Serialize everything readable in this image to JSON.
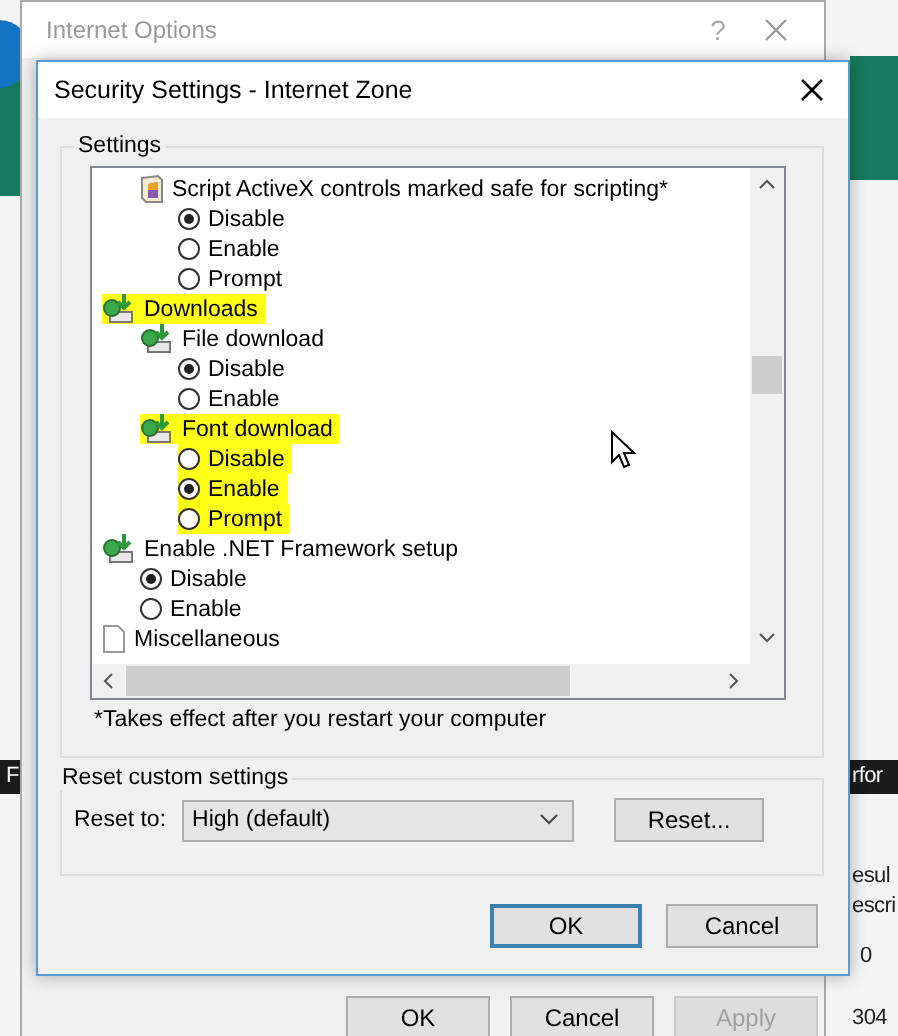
{
  "background": {
    "fragments": [
      "F",
      "rfor",
      "esul",
      "escri",
      "0",
      "304"
    ]
  },
  "internet_options": {
    "title": "Internet Options",
    "help": "?",
    "buttons": [
      {
        "label": "OK",
        "disabled": false
      },
      {
        "label": "Cancel",
        "disabled": false
      },
      {
        "label": "Apply",
        "disabled": true
      }
    ]
  },
  "dialog": {
    "title": "Security Settings - Internet Zone",
    "settings_label": "Settings",
    "tree": [
      {
        "kind": "hidden",
        "children": [
          {
            "kind": "script",
            "label": "Script ActiveX controls marked safe for scripting*",
            "highlighted": false,
            "options": [
              {
                "label": "Disable",
                "selected": true
              },
              {
                "label": "Enable",
                "selected": false
              },
              {
                "label": "Prompt",
                "selected": false
              }
            ]
          }
        ]
      },
      {
        "kind": "download",
        "label": "Downloads",
        "highlighted": true,
        "children": [
          {
            "kind": "download",
            "label": "File download",
            "highlighted": false,
            "options": [
              {
                "label": "Disable",
                "selected": true
              },
              {
                "label": "Enable",
                "selected": false
              }
            ]
          },
          {
            "kind": "download",
            "label": "Font download",
            "highlighted": true,
            "options": [
              {
                "label": "Disable",
                "selected": false
              },
              {
                "label": "Enable",
                "selected": true
              },
              {
                "label": "Prompt",
                "selected": false
              }
            ]
          }
        ]
      },
      {
        "kind": "download",
        "label": "Enable .NET Framework setup",
        "highlighted": false,
        "options": [
          {
            "label": "Disable",
            "selected": true
          },
          {
            "label": "Enable",
            "selected": false
          }
        ]
      },
      {
        "kind": "page",
        "label": "Miscellaneous",
        "highlighted": false
      }
    ],
    "note": "*Takes effect after you restart your computer",
    "reset_group": "Reset custom settings",
    "reset_to_label": "Reset to:",
    "reset_to_value": "High (default)",
    "reset_button": "Reset...",
    "buttons": [
      {
        "label": "OK",
        "default": true
      },
      {
        "label": "Cancel",
        "default": false
      }
    ]
  }
}
